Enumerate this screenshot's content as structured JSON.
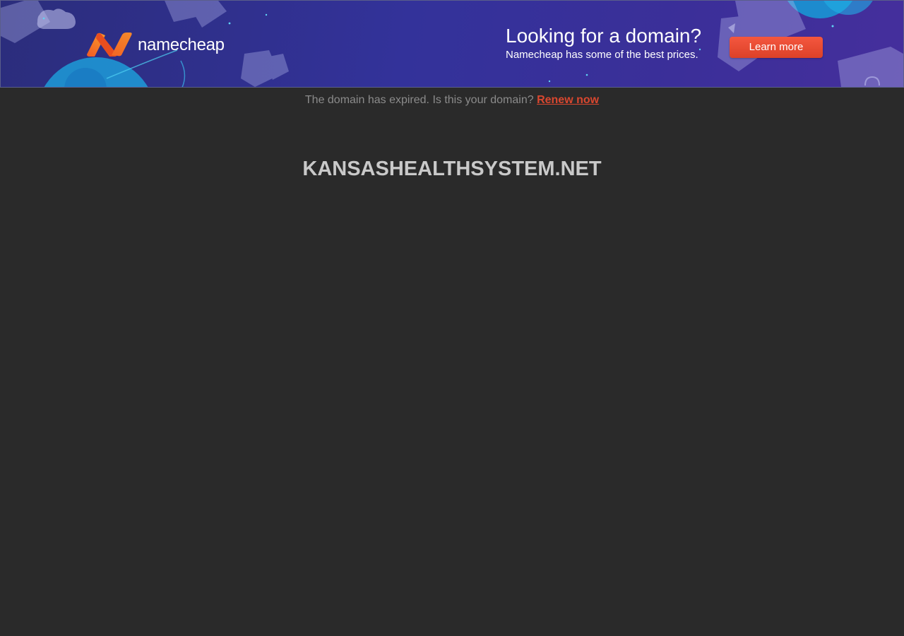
{
  "banner": {
    "brand_name": "namecheap",
    "logo_icon": "namecheap-n-logo",
    "promo_title": "Looking for a domain?",
    "promo_subtitle": "Namecheap has some of the best prices.",
    "cta_label": "Learn more"
  },
  "notice": {
    "text": "The domain has expired. Is this your domain?",
    "link_label": "Renew now"
  },
  "domain": {
    "name": "KANSASHEALTHSYSTEM.NET"
  },
  "colors": {
    "page_background": "#2a2a2a",
    "banner_background": "#33329a",
    "brand_orange": "#f26b25",
    "cta_red": "#e04a30",
    "link_red": "#d9472f",
    "notice_text": "#8b8b8b",
    "domain_text": "#c9c9c9"
  }
}
